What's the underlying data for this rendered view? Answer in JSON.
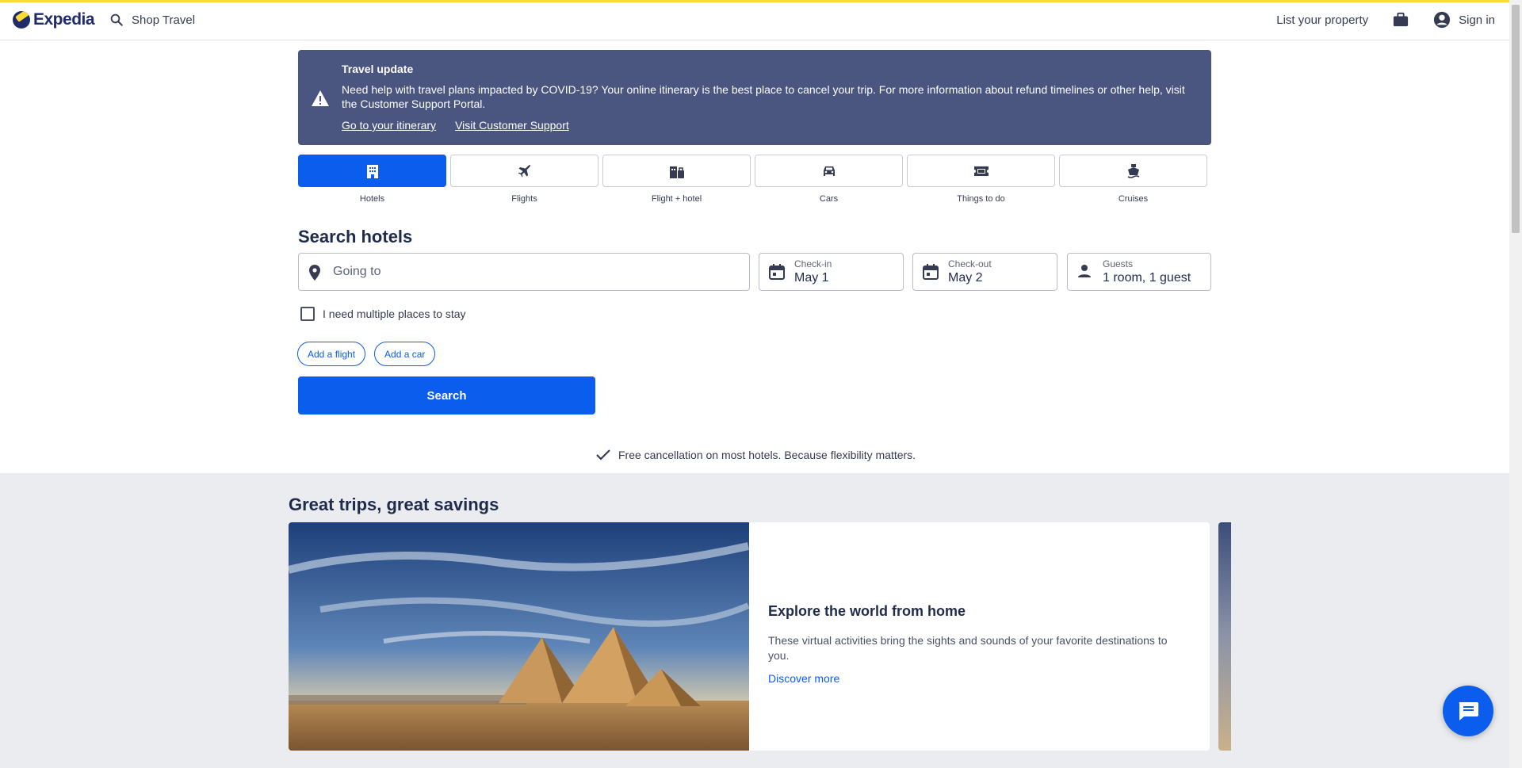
{
  "header": {
    "logo_text": "Expedia",
    "shop_label": "Shop Travel",
    "list_property": "List your property",
    "sign_in": "Sign in"
  },
  "alert": {
    "title": "Travel update",
    "body": "Need help with travel plans impacted by COVID-19? Your online itinerary is the best place to cancel your trip. For more information about refund timelines or other help, visit the Customer Support Portal.",
    "link_itinerary": "Go to your itinerary",
    "link_support": "Visit Customer Support"
  },
  "tabs": [
    {
      "label": "Hotels",
      "icon": "hotel-icon",
      "active": true
    },
    {
      "label": "Flights",
      "icon": "plane-icon"
    },
    {
      "label": "Flight + hotel",
      "icon": "flight-hotel-icon"
    },
    {
      "label": "Cars",
      "icon": "car-icon"
    },
    {
      "label": "Things to do",
      "icon": "ticket-icon"
    },
    {
      "label": "Cruises",
      "icon": "cruise-icon"
    }
  ],
  "search": {
    "title": "Search hotels",
    "going_to_placeholder": "Going to",
    "checkin_label": "Check-in",
    "checkin_value": "May 1",
    "checkout_label": "Check-out",
    "checkout_value": "May 2",
    "guests_label": "Guests",
    "guests_value": "1 room, 1 guest",
    "multi_places": "I need multiple places to stay",
    "add_flight": "Add a flight",
    "add_car": "Add a car",
    "search_button": "Search",
    "free_cancellation": "Free cancellation on most hotels. Because flexibility matters."
  },
  "promo": {
    "section_title": "Great trips, great savings",
    "card_title": "Explore the world from home",
    "card_desc": "These virtual activities bring the sights and sounds of your favorite destinations to you.",
    "card_link": "Discover more"
  },
  "colors": {
    "brand_blue": "#0a5ded",
    "alert_bg": "#4a5580",
    "brand_yellow": "#fddb32",
    "navy_text": "#1f2b4b"
  }
}
